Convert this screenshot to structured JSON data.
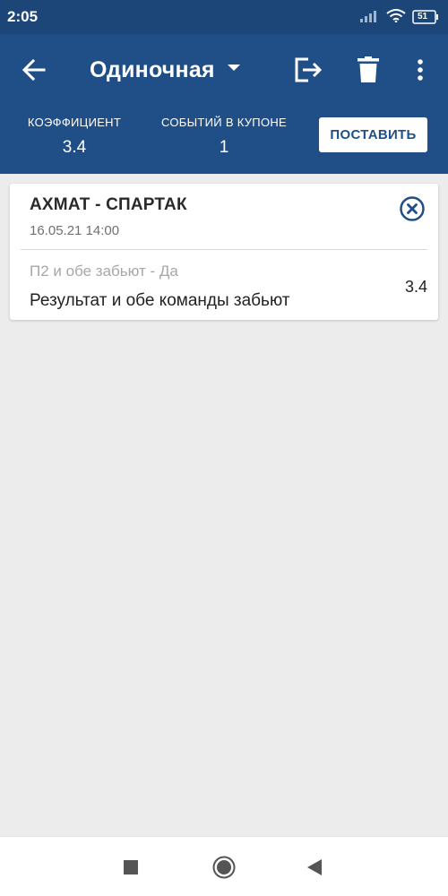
{
  "status_bar": {
    "time": "2:05",
    "battery": "51",
    "icons": [
      "signal-icon",
      "wifi-icon",
      "battery-icon"
    ]
  },
  "app_bar": {
    "title": "Одиночная",
    "icons": [
      "back-arrow-icon",
      "dropdown-caret-icon",
      "exit-icon",
      "trash-icon",
      "more-vert-icon"
    ]
  },
  "summary": {
    "coefficient_label": "КОЭФФИЦИЕНТ",
    "coefficient_value": "3.4",
    "events_label": "СОБЫТИЙ В КУПОНЕ",
    "events_value": "1",
    "place_button": "ПОСТАВИТЬ"
  },
  "bet": {
    "match": "АХМАТ - СПАРТАК",
    "datetime": "16.05.21 14:00",
    "market": "П2 и обе забьют - Да",
    "outcome": "Результат и обе команды забьют",
    "odd": "3.4"
  },
  "nav_bar": {
    "icons": [
      "square-recents-icon",
      "circle-home-icon",
      "triangle-back-icon"
    ]
  },
  "colors": {
    "header": "#1f4f86",
    "status_bar": "#1c4677",
    "background": "#ececec",
    "card": "#ffffff"
  }
}
